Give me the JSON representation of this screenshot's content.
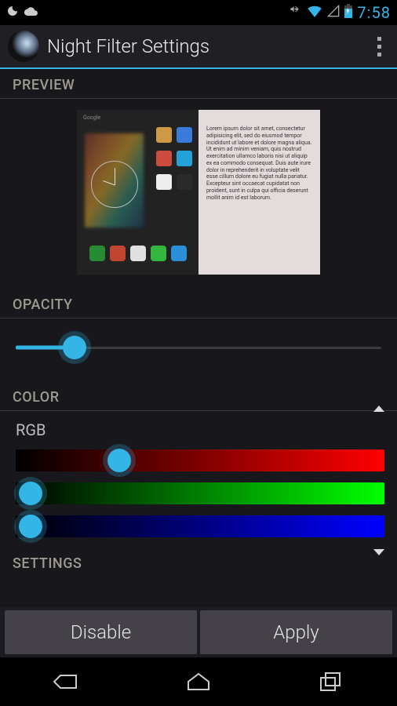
{
  "status": {
    "time": "7:58"
  },
  "app": {
    "title": "Night Filter Settings"
  },
  "sections": {
    "preview": "PREVIEW",
    "opacity": "OPACITY",
    "color": "COLOR",
    "rgb": "RGB",
    "settings": "SETTINGS"
  },
  "preview_text": "Lorem ipsum dolor sit amet, consectetur adipisicing elit, sed do eiusmod tempor incididunt ut labore et dolore magna aliqua. Ut enim ad minim veniam, quis nostrud exercitation ullamco laboris nisi ut aliquip ex ea commodo consequat. Duis aute irure dolor in reprehenderit in voluptate velit esse cillum dolore eu fugiat nulla pariatur. Excepteur sint occaecat cupidatat non proident, sunt in culpa qui officia deserunt mollit anim id est laborum.",
  "sliders": {
    "opacity": {
      "value_pct": 16
    },
    "red": {
      "value_pct": 28
    },
    "green": {
      "value_pct": 4
    },
    "blue": {
      "value_pct": 4
    }
  },
  "buttons": {
    "disable": "Disable",
    "apply": "Apply"
  }
}
